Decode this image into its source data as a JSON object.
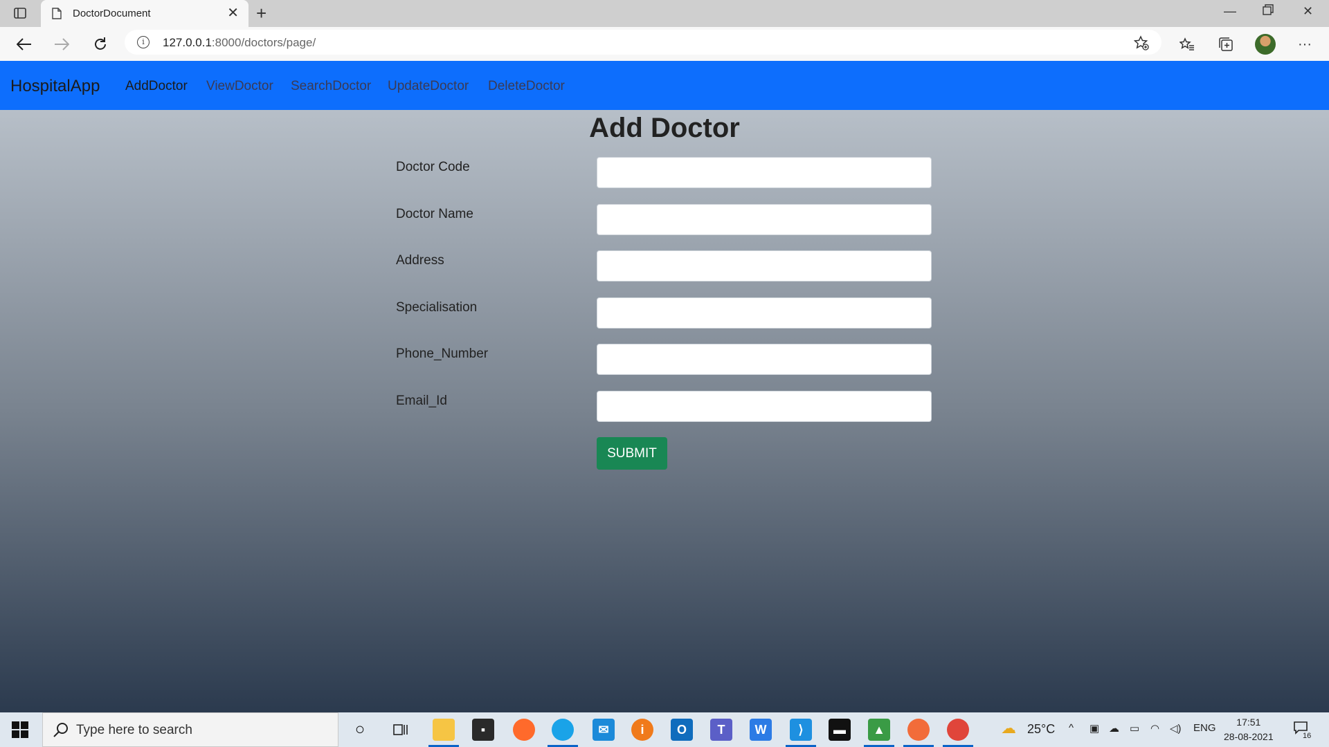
{
  "browser": {
    "tab_title": "DoctorDocument",
    "url_host": "127.0.0.1",
    "url_path": ":8000/doctors/page/"
  },
  "navbar": {
    "brand": "HospitalApp",
    "links": [
      "AddDoctor",
      "ViewDoctor",
      "SearchDoctor",
      "UpdateDoctor",
      "DeleteDoctor"
    ],
    "active_link": "AddDoctor",
    "color": "#0d6efd"
  },
  "form": {
    "title": "Add Doctor",
    "fields": [
      {
        "label": "Doctor Code",
        "value": ""
      },
      {
        "label": "Doctor Name",
        "value": ""
      },
      {
        "label": "Address",
        "value": ""
      },
      {
        "label": "Specialisation",
        "value": ""
      },
      {
        "label": "Phone_Number",
        "value": ""
      },
      {
        "label": "Email_Id",
        "value": ""
      }
    ],
    "submit_label": "SUBMIT",
    "submit_color": "#198754"
  },
  "taskbar": {
    "search_placeholder": "Type here to search",
    "weather": "25°C",
    "language": "ENG",
    "time": "17:51",
    "date": "28-08-2021",
    "notification_count": "16"
  }
}
